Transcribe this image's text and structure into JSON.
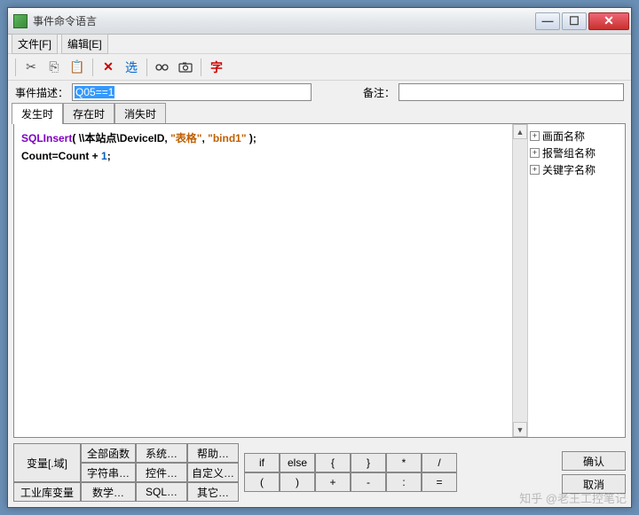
{
  "titlebar": {
    "title": "事件命令语言"
  },
  "menu": {
    "file": "文件[F]",
    "edit": "编辑[E]"
  },
  "toolbar": {
    "cut": "✂",
    "copy": "⎘",
    "paste": "📋",
    "delete": "✕",
    "select": "选",
    "find": "🔍",
    "camera": "📷",
    "font": "字"
  },
  "fields": {
    "desc_label": "事件描述：",
    "desc_value": "Q05==1",
    "remark_label": "备注：",
    "remark_value": ""
  },
  "tabs": {
    "t1": "发生时",
    "t2": "存在时",
    "t3": "消失时"
  },
  "code": {
    "l1_fn": "SQLInsert",
    "l1_open": "( ",
    "l1_path": "\\\\本站点\\DeviceID, ",
    "l1_s1": "\"表格\"",
    "l1_comma": ", ",
    "l1_s2": "\"bind1\"",
    "l1_close": " );",
    "l2_a": "Count=Count + ",
    "l2_n": "1",
    "l2_b": ";"
  },
  "tree": {
    "i1": "画面名称",
    "i2": "报警组名称",
    "i3": "关键字名称"
  },
  "cat": {
    "c00": "变量[.域]",
    "c01": "全部函数",
    "c02": "系统…",
    "c03": "帮助…",
    "c11": "字符串…",
    "c12": "控件…",
    "c13": "自定义…",
    "c20": "工业库变量",
    "c21": "数学…",
    "c22": "SQL…",
    "c23": "其它…"
  },
  "ops": {
    "r1": [
      "if",
      "else",
      "{",
      "}",
      "*",
      "/"
    ],
    "r2": [
      "(",
      ")",
      "+",
      "-",
      ":",
      "="
    ]
  },
  "actions": {
    "ok": "确认",
    "cancel": "取消"
  },
  "watermark": "知乎 @老王工控笔记"
}
